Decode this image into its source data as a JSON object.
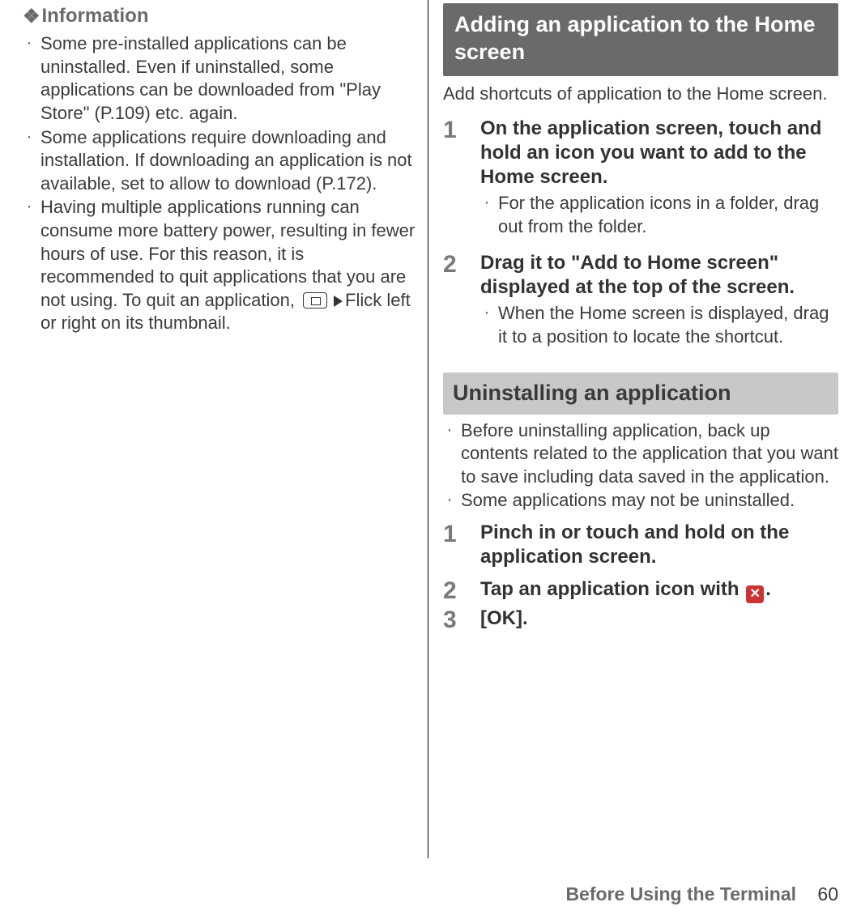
{
  "left": {
    "info_header": "Information",
    "items": [
      "Some pre-installed applications can be uninstalled. Even if uninstalled, some applications can be downloaded from \"Play Store\" (P.109) etc. again.",
      "Some applications require downloading and installation. If downloading an application is not available, set to allow to download (P.172).",
      {
        "pre": "Having multiple applications running can consume more battery power, resulting in fewer hours of use. For this reason, it is recommended to quit applications that you are not using. To quit an application, ",
        "post": "Flick left or right on its thumbnail."
      }
    ]
  },
  "right": {
    "heading1": "Adding an application to the Home screen",
    "intro1": "Add shortcuts of application to the Home screen.",
    "steps1": [
      {
        "num": "1",
        "title": "On the application screen, touch and hold an icon you want to add to the Home screen.",
        "sub": "For the application icons in a folder, drag out from the folder."
      },
      {
        "num": "2",
        "title": "Drag it to \"Add to Home screen\" displayed at the top of the screen.",
        "sub": "When the Home screen is displayed, drag it to a position to locate the shortcut."
      }
    ],
    "heading2": "Uninstalling an application",
    "notes2": [
      "Before uninstalling application, back up contents related to the application that you want to save including data saved in the application.",
      "Some applications may not be uninstalled."
    ],
    "steps2": [
      {
        "num": "1",
        "title": "Pinch in or touch and hold on the application screen."
      },
      {
        "num": "2",
        "title_pre": "Tap an application icon with ",
        "title_post": "."
      },
      {
        "num": "3",
        "title": "[OK]."
      }
    ]
  },
  "footer": {
    "label": "Before Using the Terminal",
    "page": "60"
  }
}
